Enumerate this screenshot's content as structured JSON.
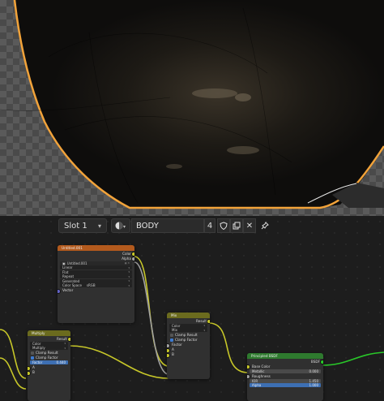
{
  "toolbar": {
    "slot_label": "Slot 1",
    "material_name": "BODY",
    "user_count": "4"
  },
  "nodes": {
    "image": {
      "title": "Untitled.001",
      "outputs": [
        "Color",
        "Alpha"
      ],
      "image_name": "Untitled.001",
      "interpolation": "Linear",
      "projection": "Flat",
      "extension": "Repeat",
      "source": "Generated",
      "color_space_label": "Color Space",
      "color_space": "sRGB",
      "input": "Vector"
    },
    "mix": {
      "title": "Mix",
      "output": "Result",
      "data_type": "Color",
      "blend": "Mix",
      "clamp_result": "Clamp Result",
      "clamp_factor": "Clamp Factor",
      "factor": "Factor",
      "a": "A",
      "b": "B"
    },
    "multiply": {
      "title": "Multiply",
      "output": "Result",
      "data_type": "Color",
      "blend": "Multiply",
      "clamp_result": "Clamp Result",
      "clamp_factor": "Clamp Factor",
      "factor_label": "Factor",
      "factor_value": "0.440",
      "a": "A",
      "b": "B"
    },
    "bsdf": {
      "title": "Principled BSDF",
      "output": "BSDF",
      "base_color": "Base Color",
      "metallic_label": "Metallic",
      "metallic_value": "0.000",
      "roughness": "Roughness",
      "ior_label": "IOR",
      "ior_value": "1.450",
      "alpha_label": "Alpha",
      "alpha_value": "1.000"
    }
  },
  "colors": {
    "selection_orange": "#f2a33a",
    "image_header": "#b35a1d",
    "color_header": "#6b6b1e",
    "shader_header": "#2e7a2e",
    "socket_color": "#c7c729",
    "socket_shader": "#29c729"
  }
}
